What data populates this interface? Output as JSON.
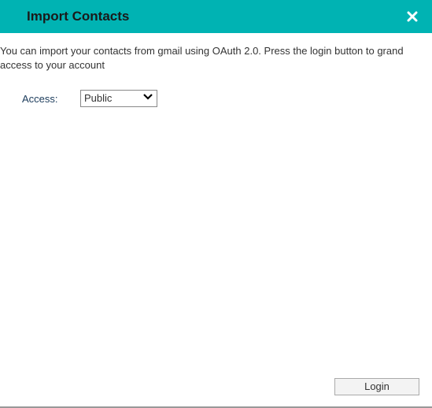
{
  "header": {
    "title": "Import Contacts"
  },
  "body": {
    "description": "You can import your contacts from gmail using OAuth 2.0. Press the login button to grand access to your account",
    "access_label": "Access:",
    "access_value": "Public"
  },
  "footer": {
    "login_label": "Login"
  }
}
